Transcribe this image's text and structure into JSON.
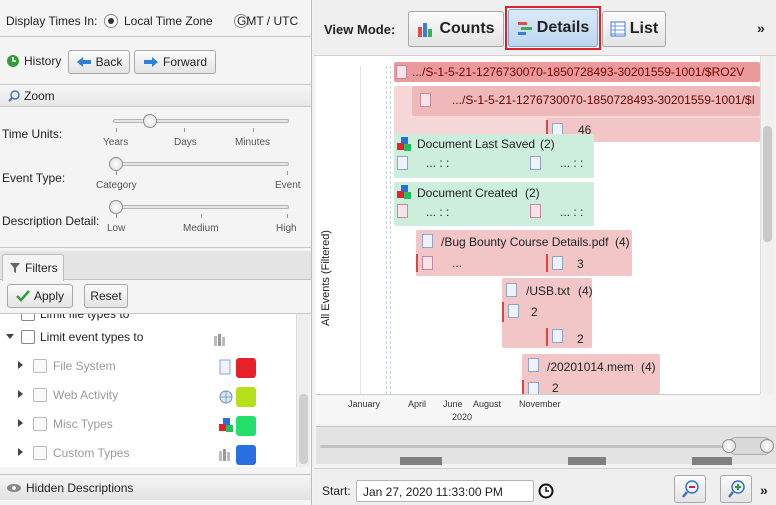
{
  "display_times": {
    "label": "Display Times In:",
    "local": "Local Time Zone",
    "gmt": "GMT / UTC"
  },
  "nav": {
    "history": "History",
    "back": "Back",
    "forward": "Forward"
  },
  "zoom": {
    "title": "Zoom",
    "time_units": {
      "label": "Time Units:",
      "ticks": [
        "Years",
        "Days",
        "Minutes"
      ],
      "level": 0.2
    },
    "event_type": {
      "label": "Event Type:",
      "ticks": [
        "Category",
        "Event"
      ],
      "level": 0
    },
    "description_detail": {
      "label": "Description Detail:",
      "ticks": [
        "Low",
        "Medium",
        "High"
      ],
      "level": 0
    }
  },
  "filters": {
    "tab": "Filters",
    "apply": "Apply",
    "reset": "Reset",
    "partial_item": "Limit file types to",
    "limit_event_types": "Limit event types to",
    "types": [
      {
        "label": "File System",
        "color": "#e8202a"
      },
      {
        "label": "Web Activity",
        "color": "#b5e01a"
      },
      {
        "label": "Misc Types",
        "color": "#24e06a"
      },
      {
        "label": "Custom Types",
        "color": "#2a6fe0"
      }
    ]
  },
  "hidden_descriptions": "Hidden Descriptions",
  "view_mode": {
    "label": "View Mode:",
    "counts": "Counts",
    "details": "Details",
    "list": "List",
    "more": "»"
  },
  "chart": {
    "y_axis_label": "All Events (Filtered)",
    "rows": {
      "path1": ".../S-1-5-21-1276730070-1850728493-30201559-1001/$RO2V",
      "path2": ".../S-1-5-21-1276730070-1850728493-30201559-1001/$I",
      "count46": "46",
      "doc_last_saved": "Document Last Saved",
      "doc_last_saved_count": "(2)",
      "dots": "... : :",
      "doc_created": "Document Created",
      "doc_created_count": "(2)",
      "bug_bounty": "/Bug Bounty Course Details.pdf",
      "bug_bounty_count": "(4)",
      "ellipsis": "...",
      "count3": "3",
      "usb": "/USB.txt",
      "usb_count": "(4)",
      "count2a": "2",
      "count2b": "2",
      "mem": "/20201014.mem",
      "mem_count": "(4)",
      "count2c": "2"
    },
    "x_axis": {
      "months": [
        "January",
        "April",
        "June",
        "August",
        "November"
      ],
      "year": "2020"
    }
  },
  "footer": {
    "start_label": "Start:",
    "start_value": "Jan 27, 2020 11:33:00 PM",
    "more": "»"
  }
}
